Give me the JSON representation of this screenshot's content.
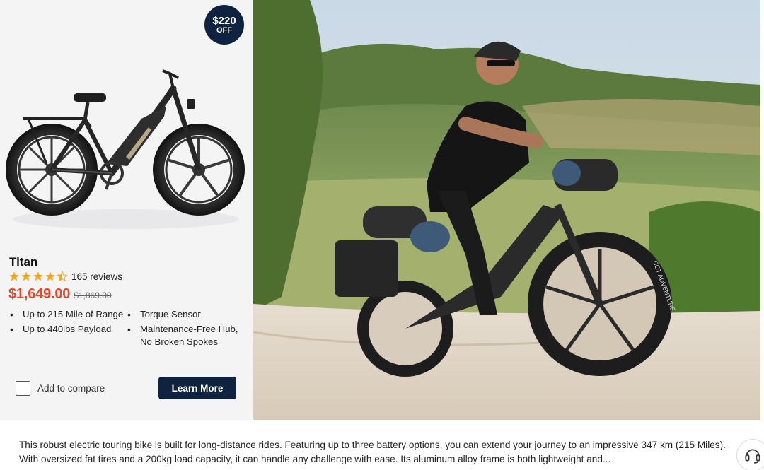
{
  "card": {
    "badge": {
      "amount": "$220",
      "label": "OFF"
    },
    "product_name": "Titan",
    "rating": {
      "stars": 4.5,
      "max_stars": 5,
      "reviews_label": "165 reviews"
    },
    "price": "$1,649.00",
    "original_price": "$1,869.00",
    "features": [
      "Up to 215 Mile of Range",
      "Torque Sensor",
      "Up to 440lbs Payload",
      "Maintenance-Free Hub, No Broken Spokes"
    ],
    "compare_label": "Add to compare",
    "compare_checked": false,
    "learn_more_label": "Learn More"
  },
  "hero": {
    "bike_branding": "CCT ADVENTURE"
  },
  "description": "This robust electric touring bike is built for long-distance rides. Featuring up to three battery options, you can extend your journey to an impressive 347 km (215 Miles). With oversized fat tires and a 200kg load capacity, it can handle any challenge with ease. Its aluminum alloy frame is both lightweight and...",
  "colors": {
    "navy": "#0f2341",
    "price_red": "#e2492a",
    "star_gold": "#f2a922"
  },
  "icons": [
    "bike-product-image",
    "star-icon",
    "checkbox-icon",
    "support-headset-icon"
  ]
}
